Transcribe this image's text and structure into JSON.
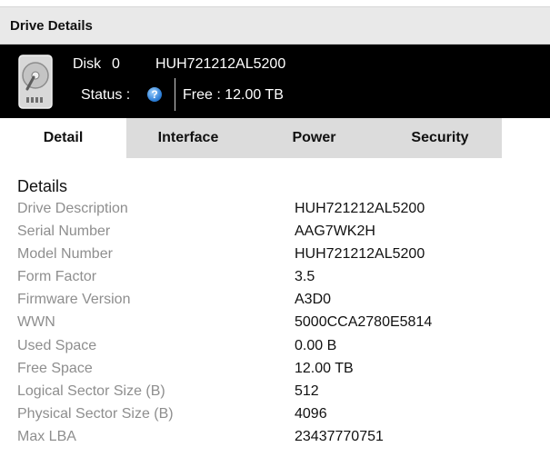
{
  "window": {
    "title": "Drive Details"
  },
  "drive": {
    "disk_label": "Disk",
    "disk_number": "0",
    "model": "HUH721212AL5200",
    "status_label": "Status :",
    "status_icon": "question-circle-icon",
    "free_label": "Free : 12.00 TB"
  },
  "tabs": [
    {
      "label": "Detail",
      "active": true
    },
    {
      "label": "Interface",
      "active": false
    },
    {
      "label": "Power",
      "active": false
    },
    {
      "label": "Security",
      "active": false
    }
  ],
  "details": {
    "section_title": "Details",
    "rows": [
      {
        "label": "Drive Description",
        "value": "HUH721212AL5200"
      },
      {
        "label": "Serial Number",
        "value": "AAG7WK2H"
      },
      {
        "label": "Model Number",
        "value": "HUH721212AL5200"
      },
      {
        "label": "Form Factor",
        "value": "3.5"
      },
      {
        "label": "Firmware Version",
        "value": "A3D0"
      },
      {
        "label": "WWN",
        "value": "5000CCA2780E5814"
      },
      {
        "label": "Used Space",
        "value": "0.00 B"
      },
      {
        "label": "Free Space",
        "value": "12.00 TB"
      },
      {
        "label": "Logical Sector Size (B)",
        "value": "512"
      },
      {
        "label": "Physical Sector Size (B)",
        "value": "4096"
      },
      {
        "label": "Max LBA",
        "value": "23437770751"
      }
    ]
  },
  "colors": {
    "header_bg": "#000000",
    "title_bar_bg": "#e9e9e9",
    "tab_bg": "#dcdcdc",
    "tab_active_bg": "#ffffff",
    "label_text": "#8e8e8e",
    "status_icon": "#2b7dd6"
  }
}
